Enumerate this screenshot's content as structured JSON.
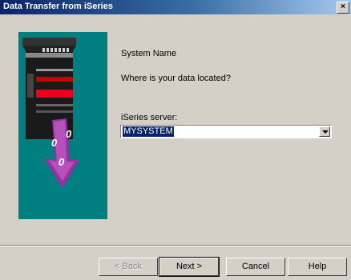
{
  "window": {
    "title": "Data Transfer from iSeries",
    "close_glyph": "×"
  },
  "content": {
    "system_name_label": "System Name",
    "question": "Where is your data located?",
    "server_label": "iSeries server:",
    "server_value": "MYSYSTEM"
  },
  "buttons": {
    "back": "< Back",
    "next": "Next >",
    "cancel": "Cancel",
    "help": "Help"
  },
  "art": {
    "bits": [
      "0",
      "0",
      "0"
    ],
    "background": "#007f80"
  }
}
